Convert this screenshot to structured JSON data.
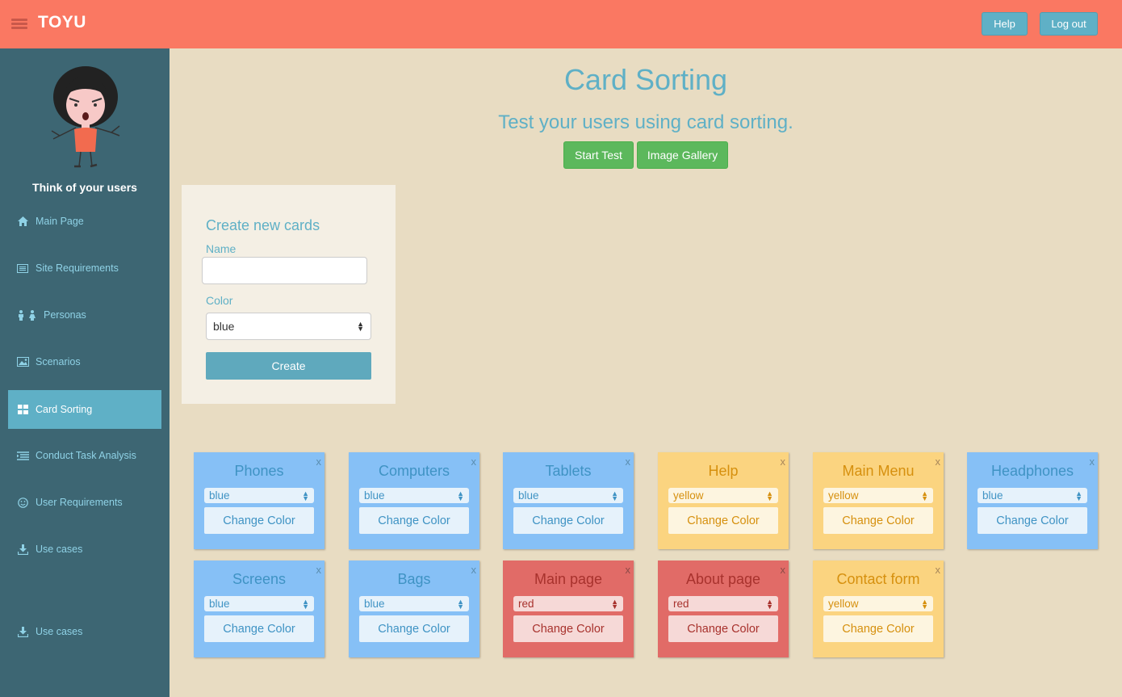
{
  "app": {
    "brand": "TOYU"
  },
  "header": {
    "help_label": "Help",
    "logout_label": "Log out"
  },
  "sidebar": {
    "tagline": "Think of your users",
    "items": [
      {
        "label": "Main Page",
        "icon": "home-icon"
      },
      {
        "label": "Site Requirements",
        "icon": "list-icon"
      },
      {
        "label": "Personas",
        "icon": "persons-icon"
      },
      {
        "label": "Scenarios",
        "icon": "picture-icon"
      },
      {
        "label": "Card Sorting",
        "icon": "grid-icon",
        "active": true
      },
      {
        "label": "Conduct Task Analysis",
        "icon": "task-list-icon"
      },
      {
        "label": "User Requirements",
        "icon": "smile-icon"
      },
      {
        "label": "Use cases",
        "icon": "download-icon"
      },
      {
        "label": "Use cases",
        "icon": "download-icon"
      }
    ]
  },
  "main": {
    "title": "Card Sorting",
    "subtitle": "Test your users using card sorting.",
    "start_test_label": "Start Test",
    "image_gallery_label": "Image Gallery"
  },
  "create_form": {
    "heading": "Create new cards",
    "name_label": "Name",
    "name_value": "",
    "color_label": "Color",
    "color_value": "blue",
    "create_label": "Create"
  },
  "cards": [
    {
      "title": "Phones",
      "color": "blue",
      "button": "Change Color",
      "close": "x"
    },
    {
      "title": "Computers",
      "color": "blue",
      "button": "Change Color",
      "close": "x"
    },
    {
      "title": "Tablets",
      "color": "blue",
      "button": "Change Color",
      "close": "x"
    },
    {
      "title": "Help",
      "color": "yellow",
      "button": "Change Color",
      "close": "x"
    },
    {
      "title": "Main Menu",
      "color": "yellow",
      "button": "Change Color",
      "close": "x"
    },
    {
      "title": "Headphones",
      "color": "blue",
      "button": "Change Color",
      "close": "x"
    },
    {
      "title": "Screens",
      "color": "blue",
      "button": "Change Color",
      "close": "x"
    },
    {
      "title": "Bags",
      "color": "blue",
      "button": "Change Color",
      "close": "x"
    },
    {
      "title": "Main page",
      "color": "red",
      "button": "Change Color",
      "close": "x"
    },
    {
      "title": "About page",
      "color": "red",
      "button": "Change Color",
      "close": "x"
    },
    {
      "title": "Contact form",
      "color": "yellow",
      "button": "Change Color",
      "close": "x"
    }
  ],
  "colors": {
    "topbar": "#fa7862",
    "sidebar": "#3d6673",
    "accent": "#5fb0c6",
    "background": "#e8dcc2",
    "card_blue": "#86c0f6",
    "card_yellow": "#fbd480",
    "card_red": "#e16b67",
    "success": "#5cb85c"
  }
}
